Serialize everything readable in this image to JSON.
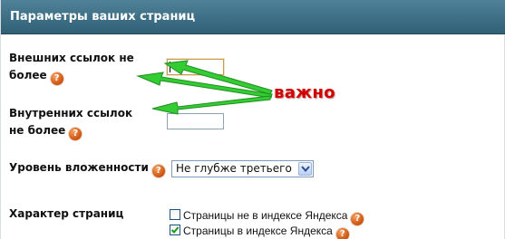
{
  "header": {
    "title": "Параметры ваших страниц"
  },
  "fields": {
    "external_links": {
      "label": "Внешних ссылок не более",
      "value": ""
    },
    "internal_links": {
      "label": "Внутренних ссылок не более",
      "value": ""
    },
    "nesting_level": {
      "label": "Уровень вложенности",
      "selected": "Не глубже третьего"
    },
    "page_type": {
      "label": "Характер страниц",
      "options": [
        {
          "label": "Страницы не в индексе Яндекса",
          "checked": false
        },
        {
          "label": "Страницы в индексе Яндекса",
          "checked": true
        }
      ]
    }
  },
  "help_icon_glyph": "?",
  "annotation": {
    "text": "важно",
    "arrow_color": "#33cc33",
    "text_color": "#d10000"
  },
  "colors": {
    "header_bg": "#3b6d84",
    "header_text": "#ffffff",
    "help_icon": "#d35b16"
  }
}
